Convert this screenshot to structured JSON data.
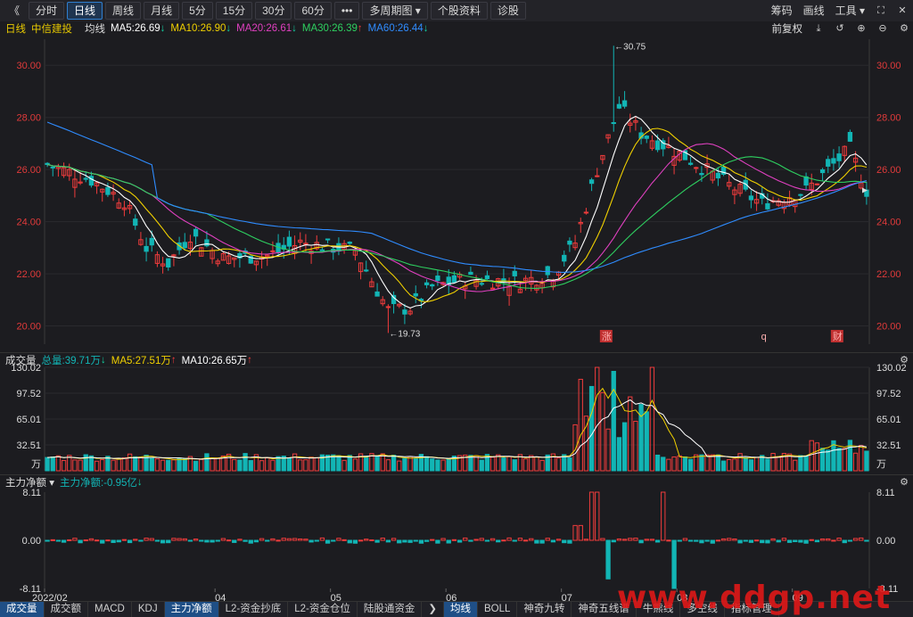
{
  "toolbar": {
    "back": "《",
    "periods": [
      "分时",
      "日线",
      "周线",
      "月线",
      "5分",
      "15分",
      "30分",
      "60分",
      "•••",
      "多周期图 ▾",
      "个股资料",
      "诊股"
    ],
    "active_index": 1,
    "right": [
      "筹码",
      "画线",
      "工具 ▾"
    ]
  },
  "info": {
    "period": "日线",
    "name": "中信建投",
    "ma_label": "均线",
    "ma5": "MA5:26.69",
    "ma10": "MA10:26.90",
    "ma20": "MA20:26.61",
    "ma30": "MA30:26.39",
    "ma60": "MA60:26.44",
    "adjust": "前复权"
  },
  "volume_bar": {
    "label": "成交量",
    "total": "总量:39.71万",
    "ma5": "MA5:27.51万",
    "ma10": "MA10:26.65万"
  },
  "net_bar": {
    "label": "主力净额 ▾",
    "value": "主力净额:-0.95亿"
  },
  "bottom_tabs": [
    "成交量",
    "成交额",
    "MACD",
    "KDJ",
    "主力净额",
    "L2-资金抄底",
    "L2-资金仓位",
    "陆股通资金",
    "均线",
    "BOLL",
    "神奇九转",
    "神奇五线谱",
    "牛熊线",
    "多空线",
    "指标管理"
  ],
  "bottom_active": [
    0,
    4,
    8
  ],
  "watermark": "www.ddgp.net",
  "colors": {
    "up": "#f03c3c",
    "down": "#12b5b5",
    "ma5": "#ffffff",
    "ma10": "#f0d000",
    "ma20": "#e040c0",
    "ma30": "#2ed060",
    "ma60": "#2f8cff"
  },
  "chart_data": [
    {
      "type": "candlestick",
      "y_ticks": [
        "30.00",
        "28.00",
        "26.00",
        "24.00",
        "22.00",
        "20.00"
      ],
      "ylim": [
        19.3,
        31.0
      ],
      "x_ticks": [
        "2022/02",
        "04",
        "05",
        "06",
        "07",
        "08",
        "09"
      ],
      "annotations": [
        "←30.75",
        "←19.73"
      ],
      "markers": [
        "涨",
        "q",
        "财"
      ],
      "ma_lines": [
        "MA5",
        "MA10",
        "MA20",
        "MA30",
        "MA60"
      ],
      "ma_values": {
        "MA5": 26.69,
        "MA10": 26.9,
        "MA20": 26.61,
        "MA30": 26.39,
        "MA60": 26.44
      },
      "high": 30.75,
      "low": 19.73,
      "close_tail": [
        27.1,
        26.9,
        26.5,
        25.2
      ]
    },
    {
      "type": "bar",
      "title": "成交量",
      "y_ticks": [
        "130.02",
        "97.52",
        "65.01",
        "32.51",
        "万"
      ],
      "ylim": [
        0,
        130.02
      ],
      "unit": "万"
    },
    {
      "type": "bar",
      "title": "主力净额",
      "y_ticks": [
        "8.11",
        "0.00",
        "-8.11"
      ],
      "ylim": [
        -8.11,
        8.11
      ]
    }
  ]
}
